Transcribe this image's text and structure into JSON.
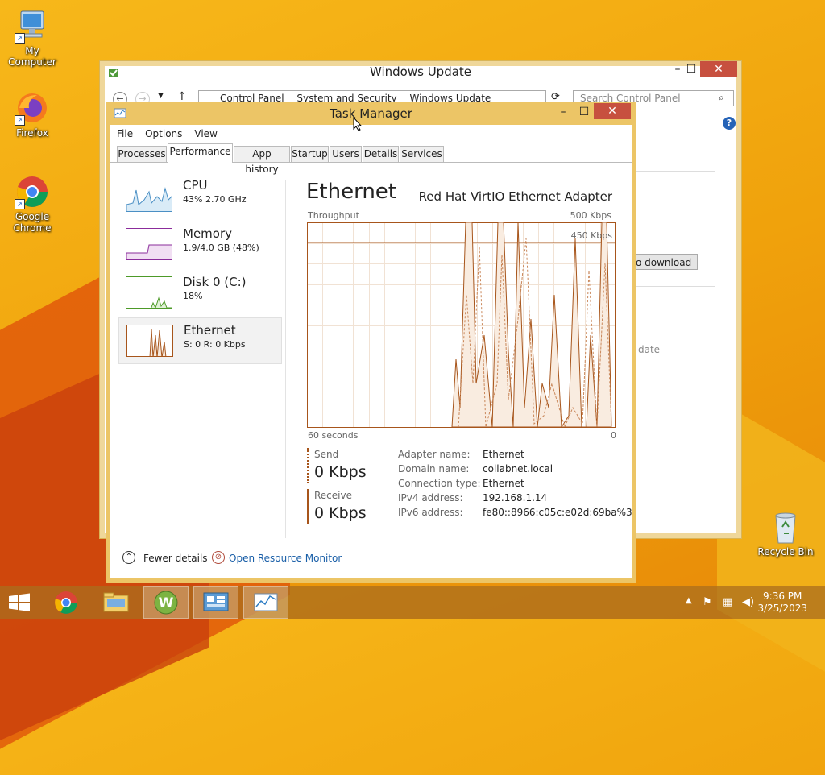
{
  "desktop": {
    "icons": [
      {
        "label": "My Computer"
      },
      {
        "label": "Firefox"
      },
      {
        "label": "Google Chrome"
      },
      {
        "label": "Recycle Bin"
      }
    ]
  },
  "windows_update": {
    "title": "Windows Update",
    "breadcrumbs": [
      "Control Panel",
      "System and Security",
      "Windows Update"
    ],
    "search_placeholder": "Search Control Panel",
    "download_button": "o download",
    "faded_text": "date"
  },
  "task_manager": {
    "title": "Task Manager",
    "menu": [
      "File",
      "Options",
      "View"
    ],
    "tabs": [
      "Processes",
      "Performance",
      "App history",
      "Startup",
      "Users",
      "Details",
      "Services"
    ],
    "selected_tab": "Performance",
    "sidebar": [
      {
        "name": "CPU",
        "sub": "43% 2.70 GHz",
        "color": "#4a8fc4"
      },
      {
        "name": "Memory",
        "sub": "1.9/4.0 GB (48%)",
        "color": "#8b2c9b"
      },
      {
        "name": "Disk 0 (C:)",
        "sub": "18%",
        "color": "#4d9a28"
      },
      {
        "name": "Ethernet",
        "sub": "S: 0 R: 0 Kbps",
        "color": "#a7551b"
      }
    ],
    "detail": {
      "heading": "Ethernet",
      "adapter": "Red Hat VirtIO Ethernet Adapter",
      "graph_label": "Throughput",
      "max_label": "500 Kbps",
      "line_label": "450 Kbps",
      "time_left": "60 seconds",
      "time_right": "0",
      "send_label": "Send",
      "send_value": "0 Kbps",
      "receive_label": "Receive",
      "receive_value": "0 Kbps",
      "properties": [
        {
          "key": "Adapter name:",
          "value": "Ethernet"
        },
        {
          "key": "Domain name:",
          "value": "collabnet.local"
        },
        {
          "key": "Connection type:",
          "value": "Ethernet"
        },
        {
          "key": "IPv4 address:",
          "value": "192.168.1.14"
        },
        {
          "key": "IPv6 address:",
          "value": "fe80::8966:c05c:e02d:69ba%3"
        }
      ]
    },
    "footer": {
      "fewer_details": "Fewer details",
      "resource_monitor": "Open Resource Monitor"
    }
  },
  "taskbar": {
    "time": "9:36 PM",
    "date": "3/25/2023"
  },
  "colors": {
    "accent_brown": "#a7551b",
    "link": "#1a5fa8",
    "titlebar": "#ecc566"
  }
}
